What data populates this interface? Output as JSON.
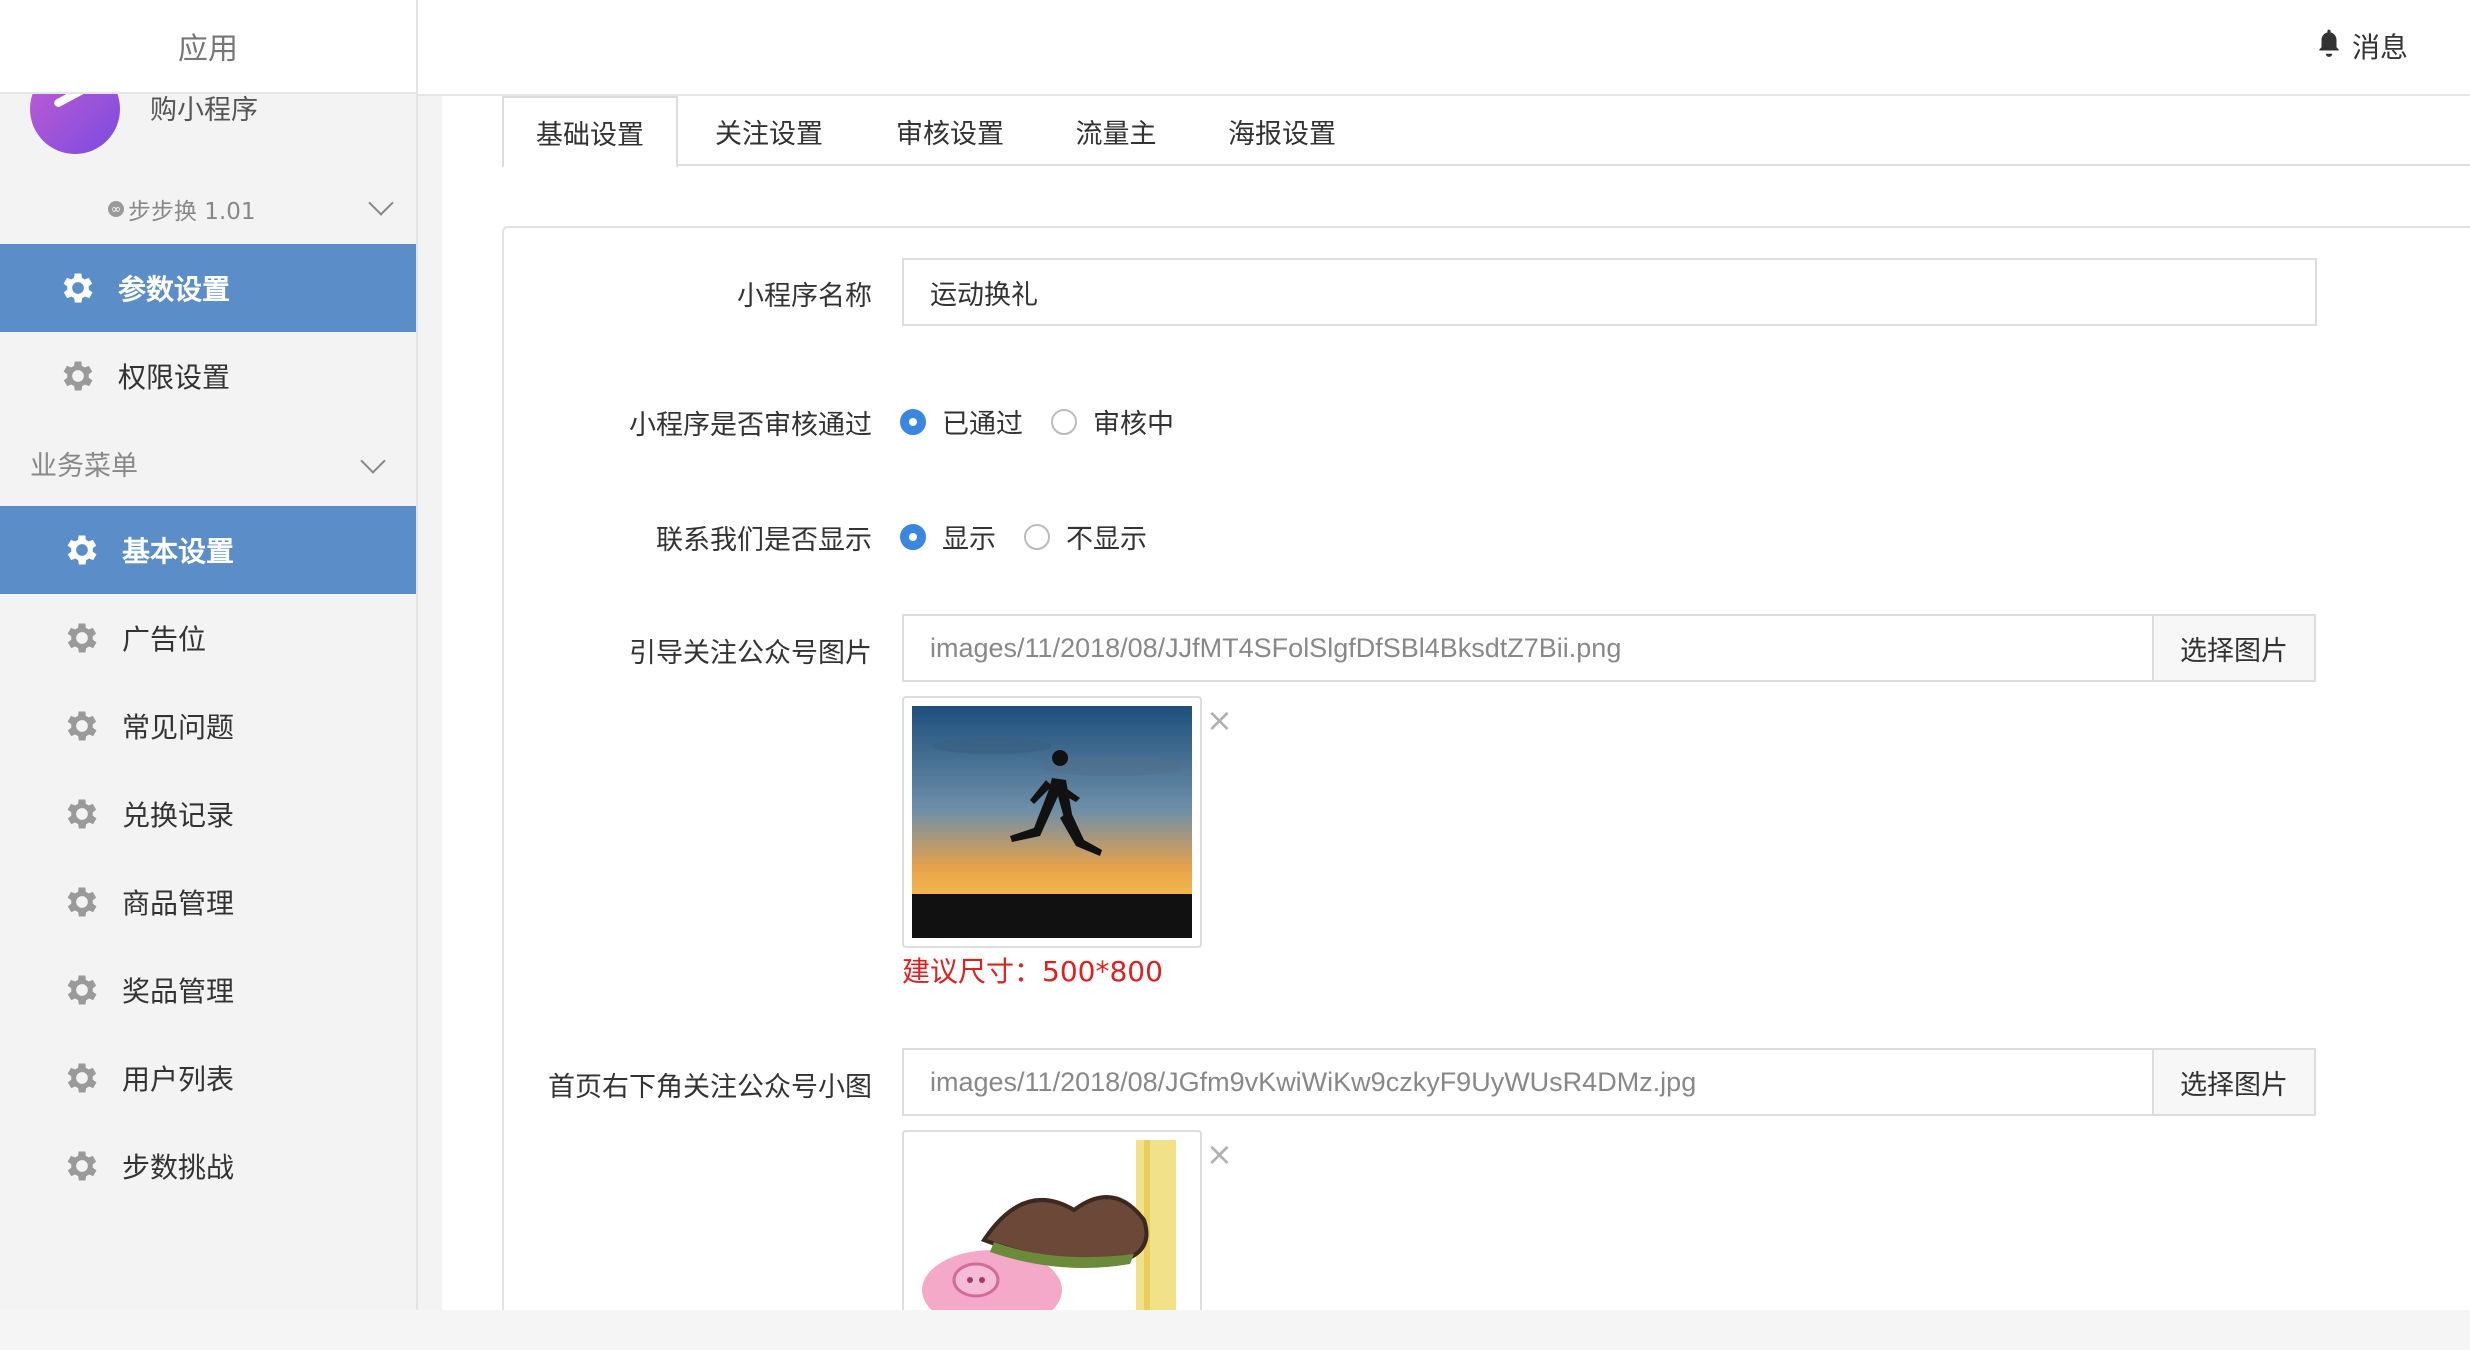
{
  "sidebar": {
    "title": "应用",
    "account_name": "购小程序",
    "account_switch": "步步换 1.01",
    "account_switch_icon": "link-icon",
    "top_items": [
      {
        "label": "参数设置",
        "icon": "gear-icon",
        "active": true
      },
      {
        "label": "权限设置",
        "icon": "gear-icon",
        "active": false
      }
    ],
    "business_menu_title": "业务菜单",
    "business_items": [
      {
        "label": "基本设置",
        "icon": "gear-icon",
        "active": true
      },
      {
        "label": "广告位",
        "icon": "gear-icon",
        "active": false
      },
      {
        "label": "常见问题",
        "icon": "gear-icon",
        "active": false
      },
      {
        "label": "兑换记录",
        "icon": "gear-icon",
        "active": false
      },
      {
        "label": "商品管理",
        "icon": "gear-icon",
        "active": false
      },
      {
        "label": "奖品管理",
        "icon": "gear-icon",
        "active": false
      },
      {
        "label": "用户列表",
        "icon": "gear-icon",
        "active": false
      },
      {
        "label": "步数挑战",
        "icon": "gear-icon",
        "active": false
      }
    ]
  },
  "topbar": {
    "messages_label": "消息",
    "messages_icon": "bell-icon"
  },
  "tabs": [
    {
      "label": "基础设置",
      "active": true
    },
    {
      "label": "关注设置",
      "active": false
    },
    {
      "label": "审核设置",
      "active": false
    },
    {
      "label": "流量主",
      "active": false
    },
    {
      "label": "海报设置",
      "active": false
    }
  ],
  "form": {
    "name_label": "小程序名称",
    "name_value": "运动换礼",
    "audit_label": "小程序是否审核通过",
    "audit_options": [
      "已通过",
      "审核中"
    ],
    "audit_selected": "已通过",
    "contact_label": "联系我们是否显示",
    "contact_options": [
      "显示",
      "不显示"
    ],
    "contact_selected": "显示",
    "guide_image_label": "引导关注公众号图片",
    "guide_image_value": "images/11/2018/08/JJfMT4SFolSlgfDfSBl4BksdtZ7Bii.png",
    "guide_image_button": "选择图片",
    "guide_image_hint": "建议尺寸：500*800",
    "corner_image_label": "首页右下角关注公众号小图",
    "corner_image_value": "images/11/2018/08/JGfm9vKwiWiKw9czkyF9UyWUsR4DMz.jpg",
    "corner_image_button": "选择图片",
    "remove_symbol": "×"
  },
  "colors": {
    "active_menu": "#5b8ec8",
    "radio_checked": "#3b87e0",
    "hint_red": "#e02020"
  }
}
